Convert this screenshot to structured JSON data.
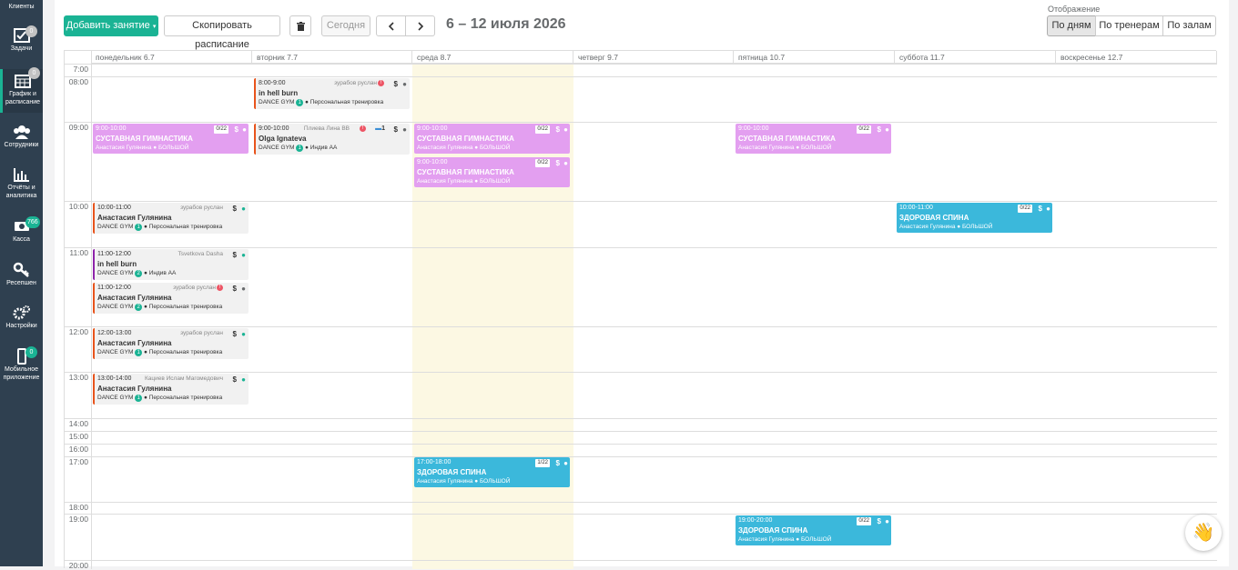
{
  "sidebar": {
    "top_label": "Клиенты",
    "items": [
      {
        "label1": "Задачи",
        "label2": "",
        "badge": "0",
        "icon": "tasks-icon"
      },
      {
        "label1": "График и",
        "label2": "расписание",
        "badge": "0",
        "icon": "calendar-icon"
      },
      {
        "label1": "Сотрудники",
        "label2": "",
        "badge": "",
        "icon": "staff-icon"
      },
      {
        "label1": "Отчёты и",
        "label2": "аналитика",
        "badge": "",
        "icon": "reports-icon"
      },
      {
        "label1": "Касса",
        "label2": "",
        "badge": "766",
        "icon": "cash-icon"
      },
      {
        "label1": "Ресепшен",
        "label2": "",
        "badge": "",
        "icon": "reception-icon"
      },
      {
        "label1": "Настройки",
        "label2": "",
        "badge": "",
        "icon": "settings-icon"
      },
      {
        "label1": "Мобильное",
        "label2": "приложение",
        "badge": "0",
        "icon": "mobile-icon"
      }
    ]
  },
  "toolbar": {
    "add_label": "Добавить занятие",
    "copy_label": "Скопировать расписание",
    "delete_icon": "trash-icon",
    "today_label": "Сегодня",
    "prev_icon": "chevron-left-icon",
    "next_icon": "chevron-right-icon",
    "week_title": "6 – 12 июля 2026",
    "view_label": "Отображение",
    "view_days": "По дням",
    "view_trainers": "По тренерам",
    "view_halls": "По залам"
  },
  "days": [
    "понедельник 6.7",
    "вторник 7.7",
    "среда 8.7",
    "четверг 9.7",
    "пятница 10.7",
    "суббота 11.7",
    "воскресенье 12.7"
  ],
  "hours": [
    "7:00",
    "08:00",
    "09:00",
    "10:00",
    "11:00",
    "12:00",
    "13:00",
    "14:00",
    "15:00",
    "16:00",
    "17:00",
    "18:00",
    "19:00",
    "20:00"
  ],
  "colors": {
    "accent": "#1ab394",
    "group_pink": "#e39ff0",
    "group_blue": "#3bb8db",
    "today": "#fcf8e3"
  },
  "events": [
    {
      "kind": "pers",
      "time": "8:00-9:00",
      "trainer": "зурабов руслан",
      "name": "in hell burn",
      "sub": "DANCE GYM",
      "num": "1",
      "type": "Персональная тренировка",
      "red": "!",
      "extra": ""
    },
    {
      "kind": "pers",
      "time": "9:00-10:00",
      "trainer": "Плиева Лина ВВ",
      "name": "Olga Ignateva",
      "sub": "DANCE GYM",
      "num": "1",
      "type": "Индив АА",
      "red": "!",
      "extra": "1"
    },
    {
      "kind": "pers",
      "time": "10:00-11:00",
      "trainer": "зурабов руслан",
      "name": "Анастасия Гулянина",
      "sub": "DANCE GYM",
      "num": "1",
      "type": "Персональная тренировка",
      "red": "",
      "extra": ""
    },
    {
      "kind": "pers",
      "time": "11:00-12:00",
      "trainer": "Tsvetkova Dasha",
      "name": "in hell burn",
      "sub": "DANCE GYM",
      "num": "2",
      "type": "Индив АА",
      "red": "",
      "extra": ""
    },
    {
      "kind": "pers",
      "time": "11:00-12:00",
      "trainer": "зурабов руслан",
      "name": "Анастасия Гулянина",
      "sub": "DANCE GYM",
      "num": "2",
      "type": "Персональная тренировка",
      "red": "!",
      "extra": ""
    },
    {
      "kind": "pers",
      "time": "12:00-13:00",
      "trainer": "зурабов руслан",
      "name": "Анастасия Гулянина",
      "sub": "DANCE GYM",
      "num": "1",
      "type": "Персональная тренировка",
      "red": "",
      "extra": ""
    },
    {
      "kind": "pers",
      "time": "13:00-14:00",
      "trainer": "Кациев Ислам Магомедович",
      "name": "Анастасия Гулянина",
      "sub": "DANCE GYM",
      "num": "1",
      "type": "Персональная тренировка",
      "red": "",
      "extra": ""
    },
    {
      "kind": "group",
      "time": "9:00-10:00",
      "occ": "0/22",
      "name": "СУСТАВНАЯ ГИМНАСТИКА",
      "sub": "Анастасия Гулянина ● БОЛЬШОЙ"
    },
    {
      "kind": "group",
      "time": "9:00-10:00",
      "occ": "0/22",
      "name": "СУСТАВНАЯ ГИМНАСТИКА",
      "sub": "Анастасия Гулянина ● БОЛЬШОЙ"
    },
    {
      "kind": "group",
      "time": "9:00-10:00",
      "occ": "0/22",
      "name": "СУСТАВНАЯ ГИМНАСТИКА",
      "sub": "Анастасия Гулянина ● БОЛЬШОЙ"
    },
    {
      "kind": "group",
      "time": "9:00-10:00",
      "occ": "0/22",
      "name": "СУСТАВНАЯ ГИМНАСТИКА",
      "sub": "Анастасия Гулянина ● БОЛЬШОЙ"
    },
    {
      "kind": "group",
      "time": "10:00-11:00",
      "occ": "0/22",
      "name": "ЗДОРОВАЯ СПИНА",
      "sub": "Анастасия Гулянина ● БОЛЬШОЙ"
    },
    {
      "kind": "group",
      "time": "17:00-18:00",
      "occ": "1/22",
      "name": "ЗДОРОВАЯ СПИНА",
      "sub": "Анастасия Гулянина ● БОЛЬШОЙ"
    },
    {
      "kind": "group",
      "time": "19:00-20:00",
      "occ": "0/22",
      "name": "ЗДОРОВАЯ СПИНА",
      "sub": "Анастасия Гулянина ● БОЛЬШОЙ"
    }
  ],
  "help_icon": "waving-hand-icon"
}
